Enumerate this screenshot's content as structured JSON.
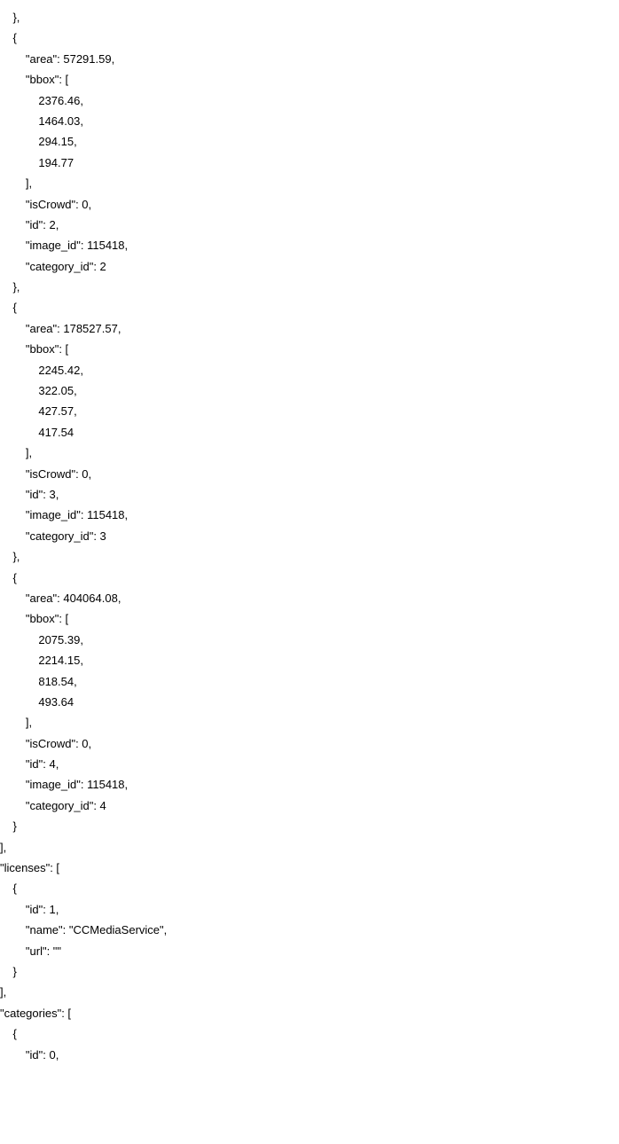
{
  "lines": [
    {
      "text": "    },",
      "indent": 0
    },
    {
      "text": "    {",
      "indent": 0
    },
    {
      "text": "",
      "indent": 0
    },
    {
      "text": "        \"area\": 57291.59,",
      "indent": 0
    },
    {
      "text": "        \"bbox\": [",
      "indent": 0
    },
    {
      "text": "            2376.46,",
      "indent": 0
    },
    {
      "text": "            1464.03,",
      "indent": 0
    },
    {
      "text": "            294.15,",
      "indent": 0
    },
    {
      "text": "            194.77",
      "indent": 0
    },
    {
      "text": "        ],",
      "indent": 0
    },
    {
      "text": "        \"isCrowd\": 0,",
      "indent": 0
    },
    {
      "text": "        \"id\": 2,",
      "indent": 0
    },
    {
      "text": "        \"image_id\": 115418,",
      "indent": 0
    },
    {
      "text": "        \"category_id\": 2",
      "indent": 0
    },
    {
      "text": "    },",
      "indent": 0
    },
    {
      "text": "    {",
      "indent": 0
    },
    {
      "text": "",
      "indent": 0
    },
    {
      "text": "        \"area\": 178527.57,",
      "indent": 0
    },
    {
      "text": "        \"bbox\": [",
      "indent": 0
    },
    {
      "text": "            2245.42,",
      "indent": 0
    },
    {
      "text": "            322.05,",
      "indent": 0
    },
    {
      "text": "            427.57,",
      "indent": 0
    },
    {
      "text": "            417.54",
      "indent": 0
    },
    {
      "text": "        ],",
      "indent": 0
    },
    {
      "text": "        \"isCrowd\": 0,",
      "indent": 0
    },
    {
      "text": "        \"id\": 3,",
      "indent": 0
    },
    {
      "text": "        \"image_id\": 115418,",
      "indent": 0
    },
    {
      "text": "        \"category_id\": 3",
      "indent": 0
    },
    {
      "text": "    },",
      "indent": 0
    },
    {
      "text": "    {",
      "indent": 0
    },
    {
      "text": "",
      "indent": 0
    },
    {
      "text": "        \"area\": 404064.08,",
      "indent": 0
    },
    {
      "text": "        \"bbox\": [",
      "indent": 0
    },
    {
      "text": "            2075.39,",
      "indent": 0
    },
    {
      "text": "            2214.15,",
      "indent": 0
    },
    {
      "text": "            818.54,",
      "indent": 0
    },
    {
      "text": "            493.64",
      "indent": 0
    },
    {
      "text": "        ],",
      "indent": 0
    },
    {
      "text": "        \"isCrowd\": 0,",
      "indent": 0
    },
    {
      "text": "        \"id\": 4,",
      "indent": 0
    },
    {
      "text": "        \"image_id\": 115418,",
      "indent": 0
    },
    {
      "text": "        \"category_id\": 4",
      "indent": 0
    },
    {
      "text": "    }",
      "indent": 0
    },
    {
      "text": "],",
      "indent": 0
    },
    {
      "text": "\"licenses\": [",
      "indent": 0
    },
    {
      "text": "    {",
      "indent": 0
    },
    {
      "text": "        \"id\": 1,",
      "indent": 0
    },
    {
      "text": "        \"name\": \"CCMediaService\",",
      "indent": 0
    },
    {
      "text": "        \"url\": \"\"",
      "indent": 0
    },
    {
      "text": "    }",
      "indent": 0
    },
    {
      "text": "],",
      "indent": 0
    },
    {
      "text": "\"categories\": [",
      "indent": 0
    },
    {
      "text": "    {",
      "indent": 0
    },
    {
      "text": "        \"id\": 0,",
      "indent": 0
    }
  ]
}
